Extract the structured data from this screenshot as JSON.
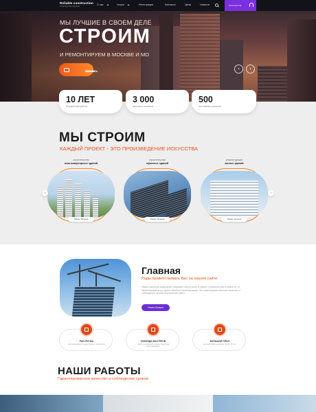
{
  "nav": {
    "logo_title": "Reliable construction",
    "logo_sub": "строительство под ключ",
    "items": [
      "О нас",
      "Услуги",
      "Регистрация",
      "Контакты",
      "Цены",
      "Новости"
    ],
    "contacts_label": "КОНТАКТЫ"
  },
  "hero": {
    "tagline": "МЫ ЛУЧШИЕ В СВОЕМ ДЕЛЕ",
    "title": "СТРОИМ",
    "subtitle": "И РЕМОНТИРУЕМ В МОСКВЕ И МО",
    "cta_line1": "ЗАКАЗАТЬ",
    "cta_line2": "ЗВОНОК",
    "prev_arrow": "‹",
    "next_arrow": "›"
  },
  "stats": [
    {
      "number": "10 ЛЕТ",
      "label": "безупречной работы"
    },
    {
      "number": "3 000",
      "label": "успешных проектов"
    },
    {
      "number": "500",
      "label": "постоянных клиентов"
    }
  ],
  "build": {
    "title": "МЫ СТРОИМ",
    "subtitle": "КАЖДЫЙ ПРОЕКТ - ЭТО ПРОИЗВЕДЕНИЕ ИСКУССТВА",
    "categories": [
      {
        "top": "строительство",
        "bottom": "многоквартирных зданий",
        "button": "Узнать больше"
      },
      {
        "top": "строительство",
        "bottom": "офисных зданий",
        "button": "Узнать больше"
      },
      {
        "top": "реконструкция",
        "bottom": "жилых зданий",
        "button": "Узнать больше"
      }
    ],
    "prev_arrow": "‹",
    "next_arrow": "›"
  },
  "main": {
    "title": "Главная",
    "subtitle": "Рады приветствовать Вас на нашем сайте.",
    "text": "Наша компания предлагает широкий спектр услуг в сфере строительства и ремонта, от проектирования до сдачи объекта в эксплуатацию. Мы гарантируем высокое качество и соблюдение сроков выполнения работ.",
    "button": "Узнать больше"
  },
  "features": [
    {
      "title": "РАССРОЧКА",
      "desc": "наша компания предоставляет рассрочку"
    },
    {
      "title": "КОМАНДА МАСТЕРОВ",
      "desc": "наши специалисты имеют высокую квалификацию"
    },
    {
      "title": "БОЛЬШОЙ ОПЫТ",
      "desc": "мы работаем на рынке более 10 лет"
    }
  ],
  "works": {
    "title": "НАШИ РАБОТЫ",
    "subtitle": "Гарантированное качество и соблюдение сроков"
  },
  "colors": {
    "accent": "#e8541c",
    "purple": "#6a2fd4",
    "nav": "#111318"
  }
}
